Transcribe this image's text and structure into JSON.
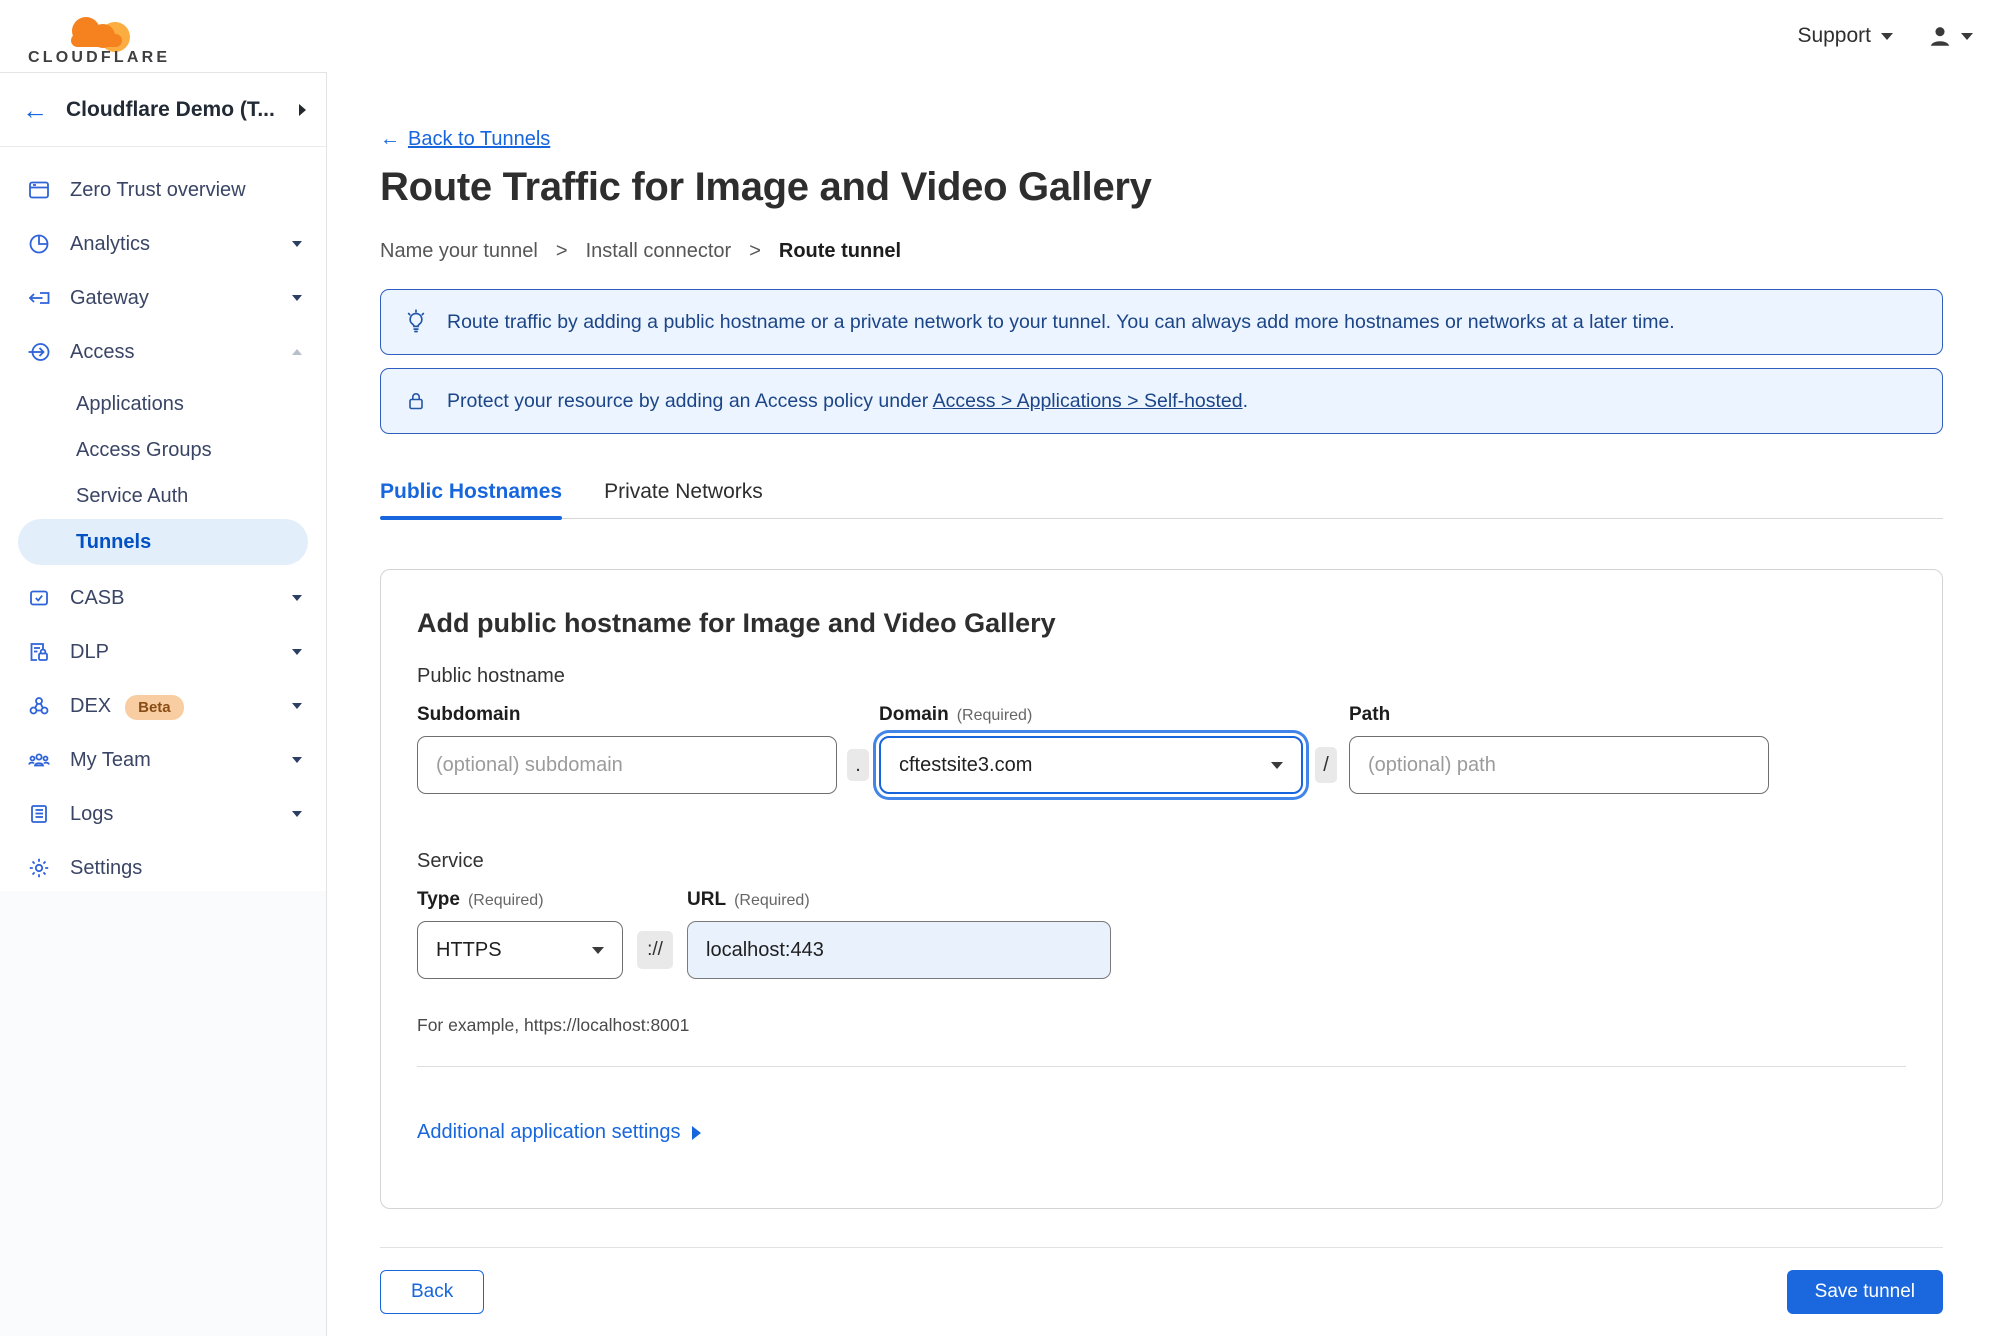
{
  "brand": {
    "logo_text": "CLOUDFLARE"
  },
  "topbar": {
    "support_label": "Support"
  },
  "sidebar": {
    "back_arrow": "←",
    "account_name": "Cloudflare Demo (T...",
    "nav": [
      {
        "label": "Zero Trust overview"
      },
      {
        "label": "Analytics"
      },
      {
        "label": "Gateway"
      },
      {
        "label": "Access"
      },
      {
        "label": "CASB"
      },
      {
        "label": "DLP"
      },
      {
        "label": "DEX",
        "badge": "Beta"
      },
      {
        "label": "My Team"
      },
      {
        "label": "Logs"
      },
      {
        "label": "Settings"
      }
    ],
    "access_sub": [
      "Applications",
      "Access Groups",
      "Service Auth",
      "Tunnels"
    ]
  },
  "main": {
    "back_arrow": "←",
    "back_link": "Back to Tunnels",
    "title": "Route Traffic for Image and Video Gallery",
    "steps": [
      "Name your tunnel",
      "Install connector",
      "Route tunnel"
    ],
    "step_separator": ">",
    "banner_route": "Route traffic by adding a public hostname or a private network to your tunnel. You can always add more hostnames or networks at a later time.",
    "banner_protect_prefix": "Protect your resource by adding an Access policy under ",
    "banner_protect_link": "Access > Applications > Self-hosted",
    "banner_protect_suffix": ".",
    "tabs": [
      {
        "label": "Public Hostnames"
      },
      {
        "label": "Private Networks"
      }
    ],
    "form": {
      "heading": "Add public hostname for Image and Video Gallery",
      "public_hostname_label": "Public hostname",
      "subdomain_label": "Subdomain",
      "subdomain_placeholder": "(optional) subdomain",
      "domain_label": "Domain",
      "domain_required": "(Required)",
      "domain_value": "cftestsite3.com",
      "path_label": "Path",
      "path_placeholder": "(optional) path",
      "sep_dot": ".",
      "sep_slash": "/",
      "sep_scheme": "://",
      "service_label": "Service",
      "type_label": "Type",
      "type_required": "(Required)",
      "type_value": "HTTPS",
      "url_label": "URL",
      "url_required": "(Required)",
      "url_value": "localhost:443",
      "example": "For example, https://localhost:8001",
      "additional_settings": "Additional application settings"
    },
    "footer": {
      "back_label": "Back",
      "save_label": "Save tunnel"
    }
  },
  "colors": {
    "accent": "#1766dd",
    "save_button": "#1a67de",
    "banner_bg": "#ebf4ff",
    "banner_border": "#2e5fc0",
    "banner_text": "#1c4587",
    "sidebar_icon_blue": "#2f63d9",
    "active_pill_bg": "#e3eefb",
    "active_pill_text": "#0051c3",
    "beta_badge_bg": "#f7cda1",
    "beta_badge_text": "#8a4d15",
    "logo_orange": "#f6821f",
    "logo_light_orange": "#fbad41"
  }
}
